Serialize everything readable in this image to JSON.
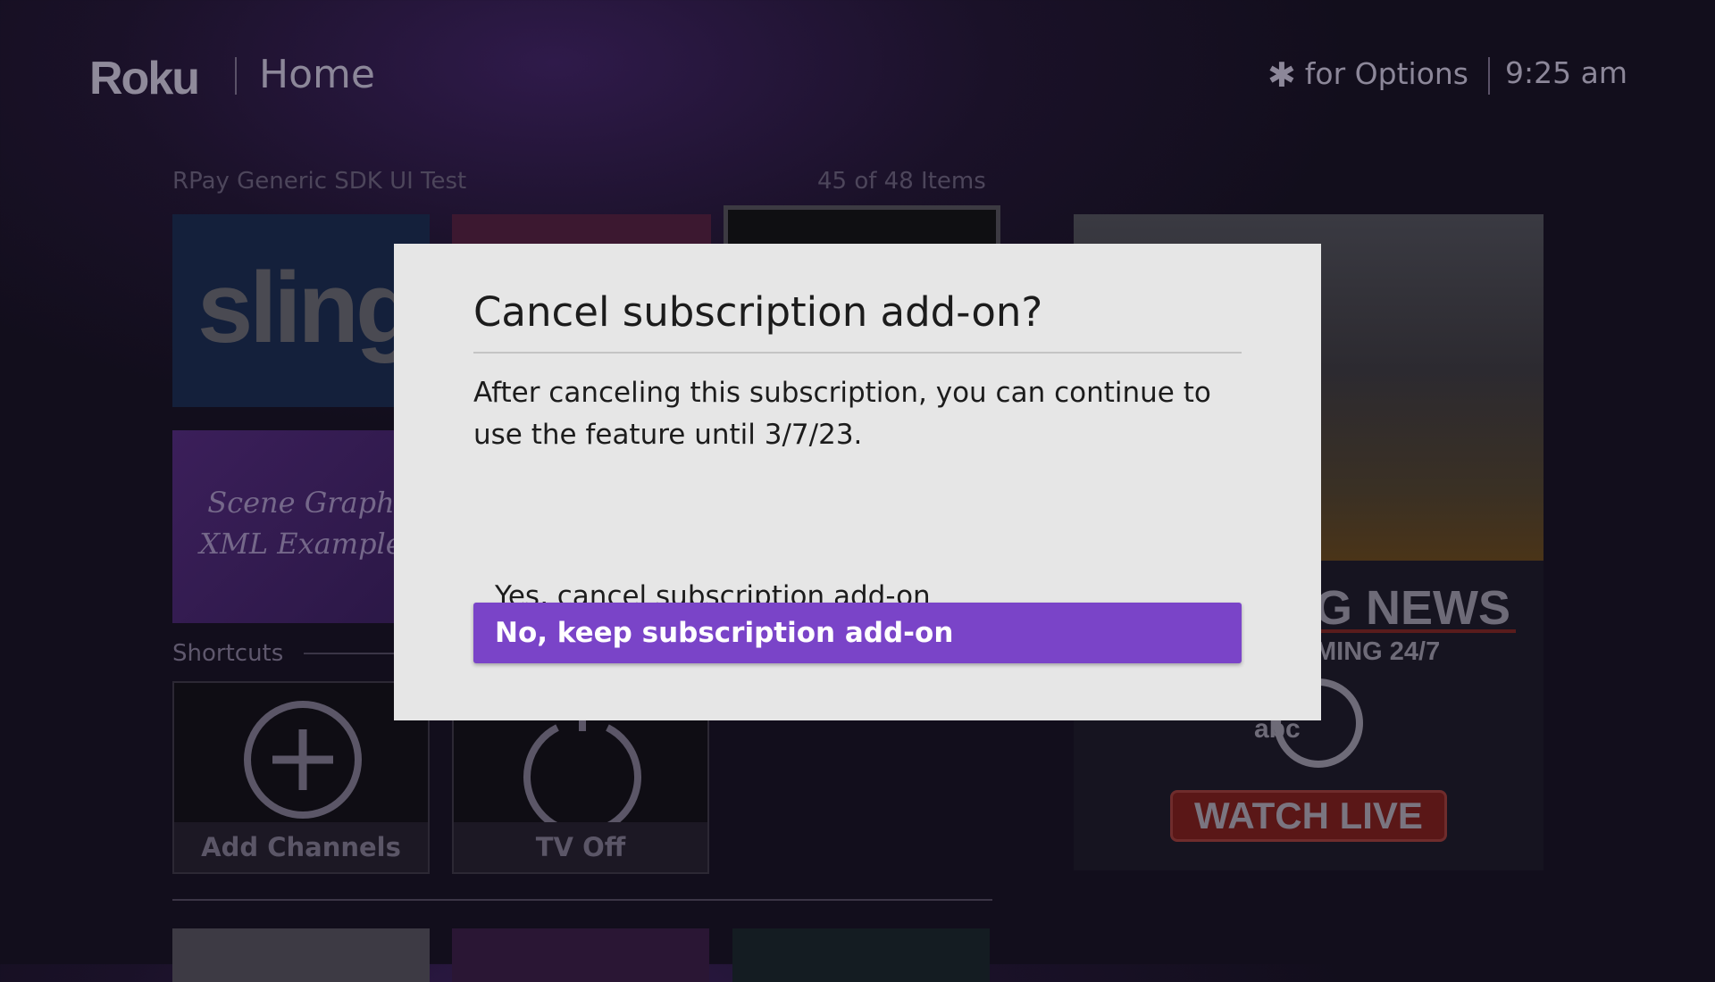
{
  "header": {
    "logo": "Roku",
    "title": "Home",
    "options_hint": "for Options",
    "time": "9:25 am"
  },
  "row": {
    "title": "RPay Generic SDK UI Test",
    "count": "45 of 48 Items"
  },
  "tiles": {
    "sling_logo": "sling",
    "scene_graph_line1": "Scene Graph",
    "scene_graph_line2": "XML Example"
  },
  "shortcuts": {
    "heading": "Shortcuts",
    "add_channels": "Add Channels",
    "tv_off": "TV Off"
  },
  "promo": {
    "headline": "G NEWS",
    "subline": "MING 24/7",
    "network": "abc",
    "button": "WATCH LIVE"
  },
  "dialog": {
    "title": "Cancel subscription add-on?",
    "body": "After canceling this subscription, you can continue to use the feature until 3/7/23.",
    "option_yes": "Yes, cancel subscription add-on",
    "option_no": "No, keep subscription add-on"
  },
  "colors": {
    "accent": "#7a44c8",
    "dialog_bg": "#e6e6e6",
    "background": "#1a1128"
  }
}
